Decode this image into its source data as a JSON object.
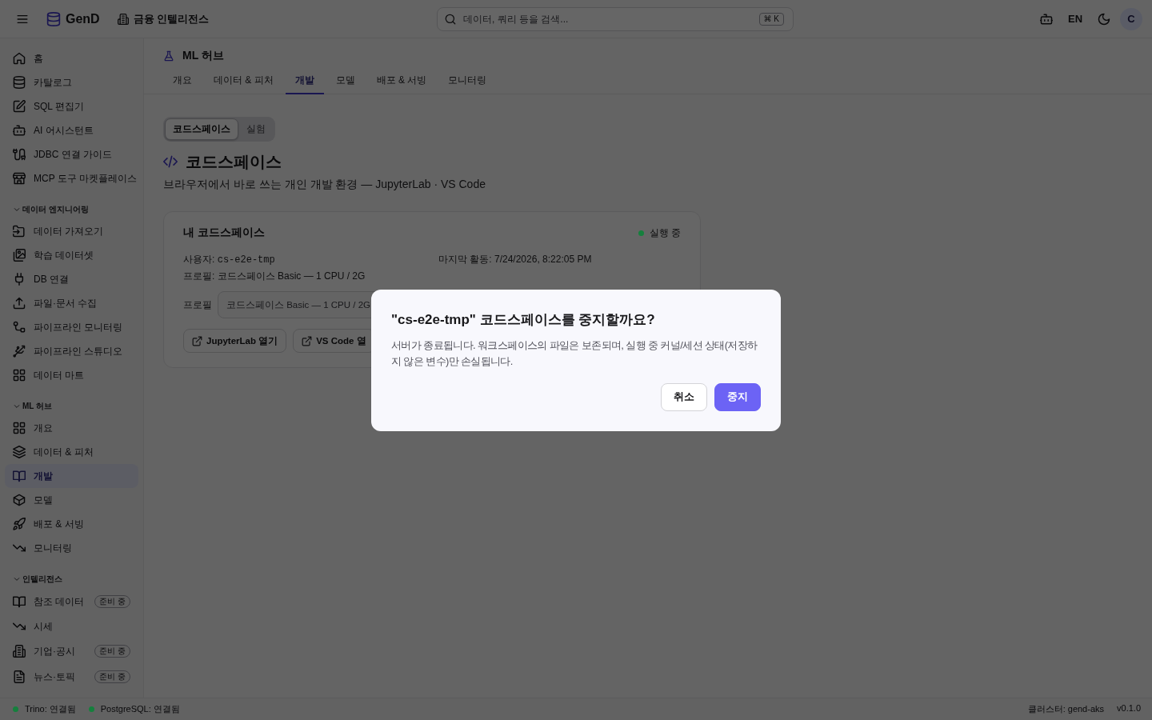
{
  "top_bar": {
    "app_name": "GenD",
    "workspace": "금융 인텔리전스",
    "search": {
      "placeholder": "데이터, 쿼리 등을 검색...",
      "shortcut": "⌘ K"
    },
    "language": "EN",
    "avatar": "C"
  },
  "sidebar": {
    "items": [
      {
        "label": "홈",
        "selected": false
      },
      {
        "label": "카탈로그",
        "selected": false
      },
      {
        "label": "SQL 편집기",
        "selected": false
      },
      {
        "label": "AI 어시스턴트",
        "selected": false
      },
      {
        "label": "JDBC 연결 가이드",
        "selected": false
      },
      {
        "label": "MCP 도구 마켓플레이스",
        "selected": false
      }
    ],
    "sections": [
      {
        "title": "데이터 엔지니어링",
        "expanded": true,
        "items": [
          {
            "label": "데이터 가져오기",
            "selected": false
          },
          {
            "label": "학습 데이터셋",
            "selected": false
          },
          {
            "label": "DB 연결",
            "selected": false
          },
          {
            "label": "파일·문서 수집",
            "selected": false
          },
          {
            "label": "파이프라인 모니터링",
            "selected": false
          },
          {
            "label": "파이프라인 스튜디오",
            "selected": false
          },
          {
            "label": "데이터 마트",
            "selected": false
          }
        ]
      },
      {
        "title": "ML 허브",
        "expanded": true,
        "items": [
          {
            "label": "개요",
            "selected": false
          },
          {
            "label": "데이터 & 피처",
            "selected": false
          },
          {
            "label": "개발",
            "selected": true
          },
          {
            "label": "모델",
            "selected": false
          },
          {
            "label": "배포 & 서빙",
            "selected": false
          },
          {
            "label": "모니터링",
            "selected": false
          }
        ]
      },
      {
        "title": "인텔리전스",
        "expanded": true,
        "items": [
          {
            "label": "참조 데이터",
            "badge": "준비 중",
            "selected": false
          },
          {
            "label": "시세",
            "selected": false
          },
          {
            "label": "기업·공시",
            "badge": "준비 중",
            "selected": false
          },
          {
            "label": "뉴스·토픽",
            "badge": "준비 중",
            "selected": false
          }
        ]
      }
    ]
  },
  "page": {
    "title": "ML 허브",
    "tabs": [
      {
        "label": "개요",
        "selected": false
      },
      {
        "label": "데이터 & 피처",
        "selected": false
      },
      {
        "label": "개발",
        "selected": true
      },
      {
        "label": "모델",
        "selected": false
      },
      {
        "label": "배포 & 서빙",
        "selected": false
      },
      {
        "label": "모니터링",
        "selected": false
      }
    ]
  },
  "content": {
    "subtabs": [
      {
        "label": "코드스페이스",
        "selected": true
      },
      {
        "label": "실험",
        "selected": false
      }
    ],
    "heading": "코드스페이스",
    "description": "브라우저에서 바로 쓰는 개인 개발 환경 — JupyterLab · VS Code",
    "card": {
      "title": "내 코드스페이스",
      "status": {
        "label": "실행 중",
        "color": "#15803d"
      },
      "user_label": "사용자:",
      "user": "cs-e2e-tmp",
      "last_activity": "마지막 활동: 7/24/2026, 8:22:05 PM",
      "profile_summary": "프로필: 코드스페이스 Basic — 1 CPU / 2G",
      "profile_select": {
        "label": "프로필",
        "value": "코드스페이스 Basic — 1 CPU / 2G",
        "disabled": true
      },
      "buttons": [
        {
          "label": "JupyterLab 열기"
        },
        {
          "label": "VS Code 열"
        }
      ]
    }
  },
  "dialog": {
    "title": "\"cs-e2e-tmp\" 코드스페이스를 중지할까요?",
    "message": "서버가 종료됩니다. 워크스페이스의 파일은 보존되며, 실행 중 커널/세션 상태(저장하지 않은 변수)만 손실됩니다.",
    "buttons": [
      {
        "label": "취소",
        "kind": "cancel"
      },
      {
        "label": "중지",
        "kind": "confirm"
      }
    ]
  },
  "status_bar": {
    "connections": [
      {
        "label": "Trino: 연결됨",
        "color": "#15803d"
      },
      {
        "label": "PostgreSQL: 연결됨",
        "color": "#15803d"
      }
    ],
    "cluster": "클러스터: gend-aks",
    "version": "v0.1.0"
  }
}
